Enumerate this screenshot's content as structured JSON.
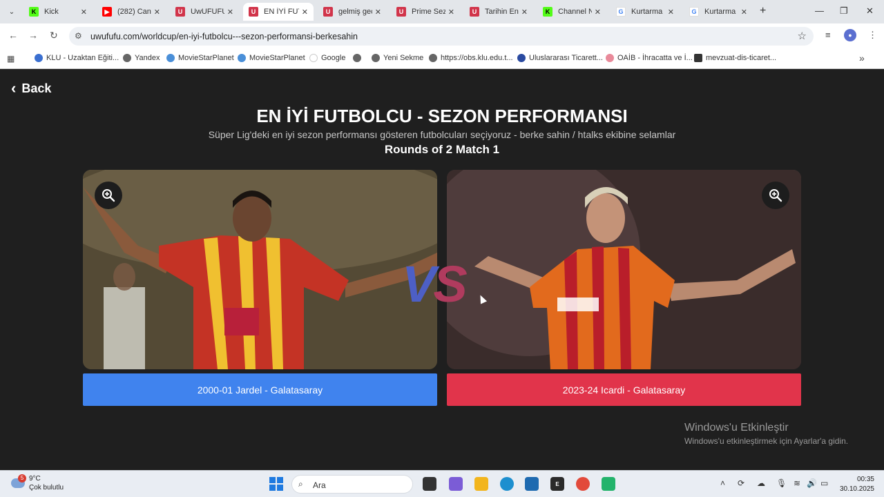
{
  "browser": {
    "tabs": [
      {
        "title": "Kick",
        "icon": "kick-icon",
        "active": false
      },
      {
        "title": "(282) Can",
        "icon": "youtube-icon",
        "active": false
      },
      {
        "title": "UwUFUFU",
        "icon": "uwufufu-icon",
        "active": false
      },
      {
        "title": "EN İYİ FUT",
        "icon": "uwufufu-icon",
        "active": true
      },
      {
        "title": "gelmiş geç",
        "icon": "uwufufu-icon",
        "active": false
      },
      {
        "title": "Prime Sez",
        "icon": "uwufufu-icon",
        "active": false
      },
      {
        "title": "Tarihin En",
        "icon": "uwufufu-icon",
        "active": false
      },
      {
        "title": "Channel N",
        "icon": "kick-icon",
        "active": false
      },
      {
        "title": "Kurtarma",
        "icon": "google-icon",
        "active": false
      },
      {
        "title": "Kurtarma",
        "icon": "google-icon",
        "active": false
      }
    ],
    "url": "uwufufu.com/worldcup/en-iyi-futbolcu---sezon-performansi-berkesahin",
    "bookmarks": [
      "KLU - Uzaktan Eğiti...",
      "Yandex",
      "MovieStarPlanet",
      "MovieStarPlanet",
      "Google",
      "",
      "Yeni Sekme",
      "https://obs.klu.edu.t...",
      "Uluslararası Ticarett...",
      "OAİB - İhracatta ve İ...",
      "mevzuat-dis-ticaret..."
    ]
  },
  "page": {
    "back_label": "Back",
    "title": "EN İYİ FUTBOLCU - SEZON PERFORMANSI",
    "subtitle": "Süper Lig'deki en iyi sezon performansı gösteren futbolcuları seçiyoruz - berke sahin / htalks ekibine selamlar",
    "round": "Rounds of 2 Match 1",
    "vs_v": "V",
    "vs_s": "S",
    "left_choice": "2000-01 Jardel - Galatasaray",
    "right_choice": "2023-24 Icardi - Galatasaray",
    "left_color": "#4083ee",
    "right_color": "#e1344b"
  },
  "watermark": {
    "line1": "Windows'u Etkinleştir",
    "line2": "Windows'u etkinleştirmek için Ayarlar'a gidin."
  },
  "taskbar": {
    "weather_temp": "9°C",
    "weather_desc": "Çok bulutlu",
    "weather_badge": "5",
    "search_placeholder": "Ara",
    "time": "00:35",
    "date": "30.10.2025"
  }
}
